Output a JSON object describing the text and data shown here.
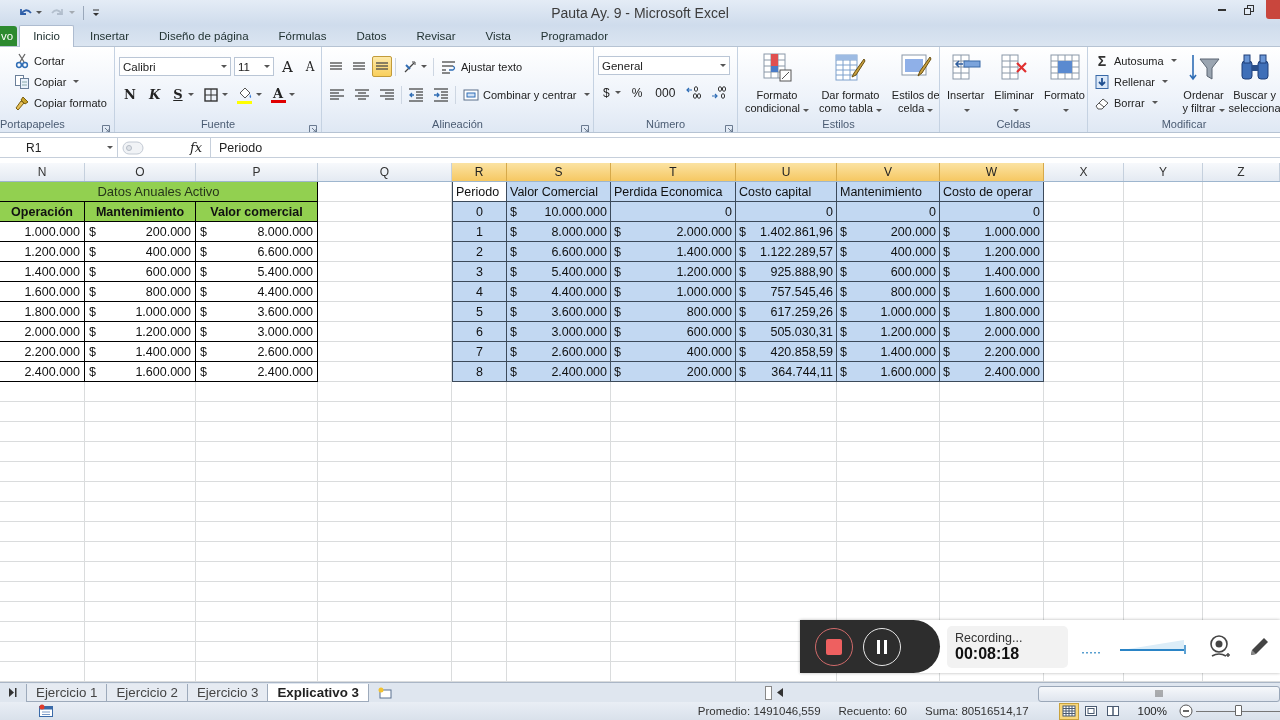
{
  "title_bar": {
    "title": "Pauta Ay. 9 - Microsoft Excel",
    "quick_access": [
      {
        "kind": "undo",
        "disabled": false
      },
      {
        "kind": "redo",
        "disabled": true
      },
      {
        "kind": "customize",
        "disabled": false
      }
    ]
  },
  "tabs": [
    {
      "label": "vo",
      "kind": "file",
      "selected": false
    },
    {
      "label": "Inicio",
      "kind": "tab",
      "selected": true
    },
    {
      "label": "Insertar",
      "kind": "tab",
      "selected": false
    },
    {
      "label": "Diseño de página",
      "kind": "tab",
      "selected": false
    },
    {
      "label": "Fórmulas",
      "kind": "tab",
      "selected": false
    },
    {
      "label": "Datos",
      "kind": "tab",
      "selected": false
    },
    {
      "label": "Revisar",
      "kind": "tab",
      "selected": false
    },
    {
      "label": "Vista",
      "kind": "tab",
      "selected": false
    },
    {
      "label": "Programador",
      "kind": "tab",
      "selected": false
    }
  ],
  "ribbon": {
    "groups": [
      {
        "label": "Portapapeles",
        "launcher": true,
        "items": [
          {
            "kind": "small",
            "label": "Cortar"
          },
          {
            "kind": "small",
            "label": "Copiar",
            "dropdown": true
          },
          {
            "kind": "small",
            "label": "Copiar formato"
          }
        ]
      },
      {
        "label": "Fuente",
        "launcher": true,
        "rows": [
          [
            {
              "kind": "combo",
              "value": "Calibri"
            },
            {
              "kind": "combo",
              "value": "11"
            },
            {
              "kind": "glyph",
              "glyph": "A"
            },
            {
              "kind": "glyph",
              "glyph": "A"
            }
          ],
          [
            {
              "kind": "glyph",
              "glyph": "N"
            },
            {
              "kind": "glyph",
              "glyph": "K"
            },
            {
              "kind": "glyph",
              "glyph": "S",
              "dropdown": true
            },
            {
              "kind": "icon",
              "dropdown": true
            },
            {
              "kind": "icon",
              "color": "#ffff00",
              "dropdown": true
            },
            {
              "kind": "glyph",
              "glyph": "A",
              "color": "#e00000",
              "dropdown": true
            }
          ]
        ]
      },
      {
        "label": "Alineación",
        "launcher": true,
        "rows": [
          [
            {
              "kind": "icon",
              "selected": false
            },
            {
              "kind": "icon",
              "selected": false
            },
            {
              "kind": "icon",
              "selected": true
            },
            {
              "kind": "icon",
              "dropdown": true
            },
            {
              "kind": "small",
              "label": "Ajustar texto"
            }
          ],
          [
            {
              "kind": "icon",
              "selected": false
            },
            {
              "kind": "icon",
              "selected": false
            },
            {
              "kind": "icon",
              "selected": false
            },
            {
              "kind": "icon"
            },
            {
              "kind": "icon"
            },
            {
              "kind": "small",
              "label": "Combinar y centrar",
              "dropdown": true
            }
          ]
        ]
      },
      {
        "label": "Número",
        "launcher": true,
        "rows": [
          [
            {
              "kind": "combo",
              "value": "General"
            }
          ],
          [
            {
              "kind": "glyph",
              "glyph": "$",
              "dropdown": true
            },
            {
              "kind": "glyph",
              "glyph": "%"
            },
            {
              "kind": "glyph",
              "glyph": "000"
            },
            {
              "kind": "icon"
            },
            {
              "kind": "icon"
            }
          ]
        ]
      },
      {
        "label": "Estilos",
        "items": [
          {
            "kind": "large",
            "lines": [
              "Formato",
              "condicional"
            ],
            "dropdown": true
          },
          {
            "kind": "large",
            "lines": [
              "Dar formato",
              "como tabla"
            ],
            "dropdown": true
          },
          {
            "kind": "large",
            "lines": [
              "Estilos de",
              "celda"
            ],
            "dropdown": true
          }
        ]
      },
      {
        "label": "Celdas",
        "items": [
          {
            "kind": "large",
            "lines": [
              "Insertar"
            ],
            "dropdown": true
          },
          {
            "kind": "large",
            "lines": [
              "Eliminar"
            ],
            "dropdown": true
          },
          {
            "kind": "large",
            "lines": [
              "Formato"
            ],
            "dropdown": true
          }
        ]
      },
      {
        "label": "Modificar",
        "items": [
          {
            "kind": "small",
            "glyph": "Σ",
            "label": "Autosuma",
            "dropdown": true
          },
          {
            "kind": "small",
            "label": "Rellenar",
            "dropdown": true
          },
          {
            "kind": "small",
            "label": "Borrar",
            "dropdown": true
          },
          {
            "kind": "large",
            "lines": [
              "Ordenar",
              "y filtrar"
            ],
            "dropdown": true
          },
          {
            "kind": "large",
            "lines": [
              "Buscar y",
              "selecciona"
            ]
          }
        ]
      }
    ]
  },
  "formula_bar": {
    "name_box": "R1",
    "function_button": "fx",
    "content": "Periodo"
  },
  "columns": [
    {
      "label": "N",
      "selected": false
    },
    {
      "label": "O",
      "selected": false
    },
    {
      "label": "P",
      "selected": false
    },
    {
      "label": "Q",
      "selected": false
    },
    {
      "label": "R",
      "selected": true
    },
    {
      "label": "S",
      "selected": true
    },
    {
      "label": "T",
      "selected": true
    },
    {
      "label": "U",
      "selected": true
    },
    {
      "label": "V",
      "selected": true
    },
    {
      "label": "W",
      "selected": true
    },
    {
      "label": "X",
      "selected": false
    },
    {
      "label": "Y",
      "selected": false
    },
    {
      "label": "Z",
      "selected": false
    }
  ],
  "left_table": {
    "title": "Datos Anuales Activo",
    "headers": [
      "Operación",
      "Mantenimiento",
      "Valor comercial"
    ],
    "rows": [
      [
        {
          "value": "1.000.000"
        },
        {
          "symbol": "$",
          "value": "200.000"
        },
        {
          "symbol": "$",
          "value": "8.000.000"
        }
      ],
      [
        {
          "value": "1.200.000"
        },
        {
          "symbol": "$",
          "value": "400.000"
        },
        {
          "symbol": "$",
          "value": "6.600.000"
        }
      ],
      [
        {
          "value": "1.400.000"
        },
        {
          "symbol": "$",
          "value": "600.000"
        },
        {
          "symbol": "$",
          "value": "5.400.000"
        }
      ],
      [
        {
          "value": "1.600.000"
        },
        {
          "symbol": "$",
          "value": "800.000"
        },
        {
          "symbol": "$",
          "value": "4.400.000"
        }
      ],
      [
        {
          "value": "1.800.000"
        },
        {
          "symbol": "$",
          "value": "1.000.000"
        },
        {
          "symbol": "$",
          "value": "3.600.000"
        }
      ],
      [
        {
          "value": "2.000.000"
        },
        {
          "symbol": "$",
          "value": "1.200.000"
        },
        {
          "symbol": "$",
          "value": "3.000.000"
        }
      ],
      [
        {
          "value": "2.200.000"
        },
        {
          "symbol": "$",
          "value": "1.400.000"
        },
        {
          "symbol": "$",
          "value": "2.600.000"
        }
      ],
      [
        {
          "value": "2.400.000"
        },
        {
          "symbol": "$",
          "value": "1.600.000"
        },
        {
          "symbol": "$",
          "value": "2.400.000"
        }
      ]
    ]
  },
  "right_table": {
    "selected": true,
    "headers": [
      {
        "text": "Periodo",
        "active": true
      },
      {
        "text": "Valor Comercial",
        "active": false
      },
      {
        "text": "Perdida Economica",
        "active": false
      },
      {
        "text": "Costo capital",
        "active": false
      },
      {
        "text": "Mantenimiento",
        "active": false
      },
      {
        "text": "Costo de operar",
        "active": false
      }
    ],
    "rows": [
      [
        {
          "value": "0"
        },
        {
          "symbol": "$",
          "value": "10.000.000"
        },
        {
          "value": "0"
        },
        {
          "value": "0"
        },
        {
          "value": "0"
        },
        {
          "value": "0"
        }
      ],
      [
        {
          "value": "1"
        },
        {
          "symbol": "$",
          "value": "8.000.000"
        },
        {
          "symbol": "$",
          "value": "2.000.000"
        },
        {
          "symbol": "$",
          "value": "1.402.861,96"
        },
        {
          "symbol": "$",
          "value": "200.000"
        },
        {
          "symbol": "$",
          "value": "1.000.000"
        }
      ],
      [
        {
          "value": "2"
        },
        {
          "symbol": "$",
          "value": "6.600.000"
        },
        {
          "symbol": "$",
          "value": "1.400.000"
        },
        {
          "symbol": "$",
          "value": "1.122.289,57"
        },
        {
          "symbol": "$",
          "value": "400.000"
        },
        {
          "symbol": "$",
          "value": "1.200.000"
        }
      ],
      [
        {
          "value": "3"
        },
        {
          "symbol": "$",
          "value": "5.400.000"
        },
        {
          "symbol": "$",
          "value": "1.200.000"
        },
        {
          "symbol": "$",
          "value": "925.888,90"
        },
        {
          "symbol": "$",
          "value": "600.000"
        },
        {
          "symbol": "$",
          "value": "1.400.000"
        }
      ],
      [
        {
          "value": "4"
        },
        {
          "symbol": "$",
          "value": "4.400.000"
        },
        {
          "symbol": "$",
          "value": "1.000.000"
        },
        {
          "symbol": "$",
          "value": "757.545,46"
        },
        {
          "symbol": "$",
          "value": "800.000"
        },
        {
          "symbol": "$",
          "value": "1.600.000"
        }
      ],
      [
        {
          "value": "5"
        },
        {
          "symbol": "$",
          "value": "3.600.000"
        },
        {
          "symbol": "$",
          "value": "800.000"
        },
        {
          "symbol": "$",
          "value": "617.259,26"
        },
        {
          "symbol": "$",
          "value": "1.000.000"
        },
        {
          "symbol": "$",
          "value": "1.800.000"
        }
      ],
      [
        {
          "value": "6"
        },
        {
          "symbol": "$",
          "value": "3.000.000"
        },
        {
          "symbol": "$",
          "value": "600.000"
        },
        {
          "symbol": "$",
          "value": "505.030,31"
        },
        {
          "symbol": "$",
          "value": "1.200.000"
        },
        {
          "symbol": "$",
          "value": "2.000.000"
        }
      ],
      [
        {
          "value": "7"
        },
        {
          "symbol": "$",
          "value": "2.600.000"
        },
        {
          "symbol": "$",
          "value": "400.000"
        },
        {
          "symbol": "$",
          "value": "420.858,59"
        },
        {
          "symbol": "$",
          "value": "1.400.000"
        },
        {
          "symbol": "$",
          "value": "2.200.000"
        }
      ],
      [
        {
          "value": "8"
        },
        {
          "symbol": "$",
          "value": "2.400.000"
        },
        {
          "symbol": "$",
          "value": "200.000"
        },
        {
          "symbol": "$",
          "value": "364.744,11"
        },
        {
          "symbol": "$",
          "value": "1.600.000"
        },
        {
          "symbol": "$",
          "value": "2.400.000"
        }
      ]
    ]
  },
  "sheet_tabs": [
    {
      "label": "Ejercicio 1",
      "selected": false
    },
    {
      "label": "Ejercicio 2",
      "selected": false
    },
    {
      "label": "Ejercicio 3",
      "selected": false
    },
    {
      "label": "Explicativo 3",
      "selected": true
    }
  ],
  "status_bar": {
    "average": "Promedio: 1491046,559",
    "count": "Recuento: 60",
    "sum": "Suma: 80516514,17",
    "views": [
      {
        "kind": "normal",
        "selected": true
      },
      {
        "kind": "layout",
        "selected": false
      },
      {
        "kind": "pagebreak",
        "selected": false
      }
    ],
    "zoom": "100%",
    "zoom_slider": {
      "level": 0.5
    }
  },
  "recorder": {
    "status": "Recording...",
    "time": "00:08:18"
  }
}
